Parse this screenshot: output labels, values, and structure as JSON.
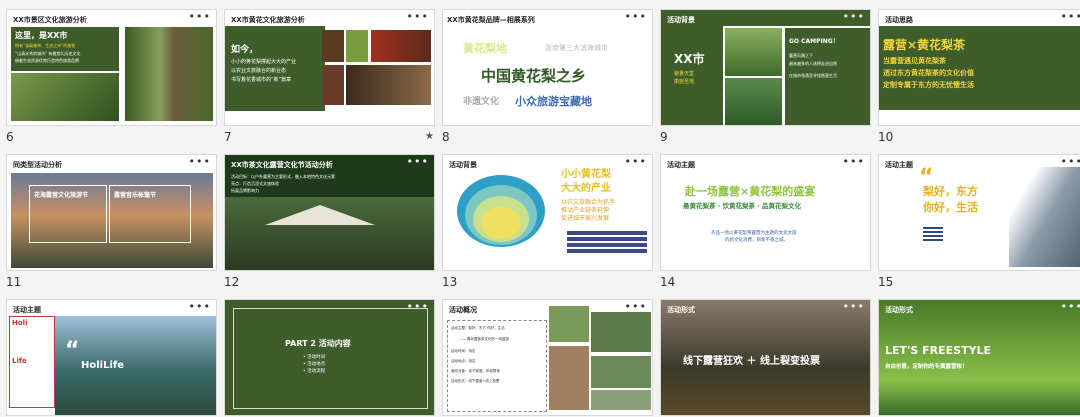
{
  "slides": [
    {
      "num": "6",
      "title": "XX市景区文化旅游分析",
      "heading": "这里，是XX市",
      "l1": "拥有“省级森林、生态之市”的美誉",
      "l2": "“山清水秀的城市” 有着悠久历史文化",
      "l3": "借着生态资源优势打造特色旅游品牌"
    },
    {
      "num": "7",
      "title": "XX市黄花文化旅游分析",
      "l1": "如今，",
      "l2": "小小的黄花梨撑起大大的产业",
      "l3": "以农业文旅融合的新业态",
      "l4": "书写着花香城市的“新”篇章"
    },
    {
      "num": "8",
      "title": "XX市黄花梨品牌—相展系列",
      "t1": "黄花梨地",
      "t2": "浙南第三大滨海城市",
      "t3": "中国黄花梨之乡",
      "t4": "非遗文化",
      "t5": "小众旅游宝藏地"
    },
    {
      "num": "9",
      "title": "活动背景",
      "h": "XX市",
      "s1": "避暑天堂",
      "s2": "康旅圣地",
      "r1": "GO CAMPING！",
      "r2": "露营风潮之下",
      "r3": "越来越多的人选择走进自然",
      "r4": "在城市角落里寻找惬意生活"
    },
    {
      "num": "10",
      "title": "活动思路",
      "h1": "露营×黄花梨茶",
      "h2": "当露营遇见黄花梨茶",
      "h3": "透过东方黄花梨茶的文化价值",
      "h4": "定制专属于东方的无忧慢生活"
    },
    {
      "num": "11",
      "title": "同类型活动分析",
      "b1": "花海露营文化旅游节",
      "b2": "露营音乐帐篷节"
    },
    {
      "num": "12",
      "title": "XX市茶文化露营文化节活动分析",
      "l1": "活动目标：以户外露营为主要形式，融入本地特色文化元素",
      "l2": "亮点：打造沉浸式文旅体验",
      "l3": "拓展品牌影响力"
    },
    {
      "num": "13",
      "title": "活动背景",
      "h1": "小小黄花梨",
      "h2": "大大的产业",
      "s1": "以农文旅融合为抓手",
      "s2": "推动产业链条延伸",
      "s3": "促进城市振兴发展"
    },
    {
      "num": "14",
      "title": "活动主题",
      "h1": "赴一场露营×黄花梨的盛宴",
      "h2": "悬黄花梨茶 · 饮黄花梨茶 · 品黄花梨文化",
      "s1": "齐品一场以黄花梨茶露营为主题的文化文旅",
      "s2": "的新文化消费，崭新不夜之城。"
    },
    {
      "num": "15",
      "title": "活动主题",
      "q": "“",
      "h1": "梨好，东方",
      "h2": "你好，生活"
    },
    {
      "num": "16",
      "title": "活动主题",
      "hl": "Holi",
      "lf": "Life",
      "big": "HoliLife",
      "q": "“"
    },
    {
      "num": "17",
      "h": "PART 2 活动内容",
      "i1": "活动时间",
      "i2": "活动地点",
      "i3": "活动流程"
    },
    {
      "num": "18",
      "title": "活动概况",
      "l1": "活动主题：梨好，东方 你好，生活",
      "l2": "——喜欢露营茶文化的一场盛宴",
      "l3": "活动时间：待定",
      "l4": "活动地点：待定",
      "l5": "面向对象：亲子家庭、年轻群体",
      "l6": "活动形式：线下露营+线上投票"
    },
    {
      "num": "19",
      "title": "活动形式",
      "h": "线下露营狂欢 ＋ 线上裂变投票"
    },
    {
      "num": "20",
      "title": "活动形式",
      "h": "LET'S FREESTYLE",
      "s": "自由创意，定制你的专属露营帐！"
    }
  ]
}
